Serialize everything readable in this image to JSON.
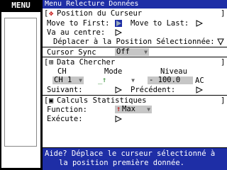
{
  "menu_tab": "MENU",
  "window_title": "Menu Relecture Données",
  "sections": {
    "cursor_position": {
      "title": "Position du Curseur",
      "move_first": "Move to First:",
      "move_last": "Move to Last:",
      "go_center": "Va au centre:",
      "move_to_selected": "Déplacer à la Position Sélectionnée:"
    },
    "cursor_sync": {
      "label": "Cursor Sync",
      "value": "Off"
    },
    "data_search": {
      "title": "Data Chercher",
      "col_ch": "CH",
      "col_mode": "Mode",
      "col_level": "Niveau",
      "ch_value": "CH 1",
      "mode_value": "↑",
      "level_value": "- 100.0",
      "level_unit": "AC",
      "next": "Suivant:",
      "previous": "Précédent:"
    },
    "stats": {
      "title": "Calculs Statistiques",
      "function_label": "Function:",
      "function_value": "Max",
      "execute_label": "Exécute:"
    }
  },
  "help_text_1": "Aide? Déplace le curseur sélectionné à",
  "help_text_2": "la position première donnée.",
  "colors": {
    "titlebar": "#1e2ea6",
    "play_button": "#1e2ea6",
    "dropdown": "#c6c6c6"
  }
}
